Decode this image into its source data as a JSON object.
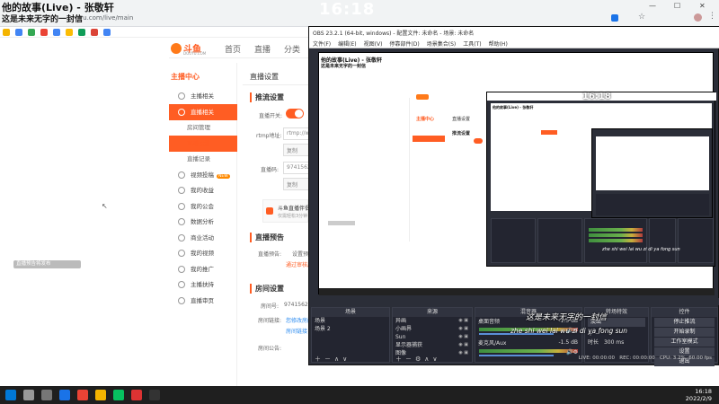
{
  "overlay": {
    "song_title": "他的故事(Live) - 张敬轩",
    "song_subtitle": "这是未来无字的一封信",
    "clock": "16:18",
    "lyric_cn": "这是未来无字的一封信",
    "lyric_pinyin": "zhe shi wei lai wu zi di ya fong sun"
  },
  "browser": {
    "address": "yu.com/live/main",
    "right_icons": [
      "extension-icon",
      "star-icon",
      "menu-icon"
    ]
  },
  "douyu": {
    "logo_text": "斗鱼",
    "logo_sub": "DOUYU.COM",
    "nav": [
      "首页",
      "直播",
      "分类"
    ],
    "menu_title": "主播中心",
    "menu": [
      {
        "label": "主播相关",
        "icon": "user-icon",
        "active": false,
        "sub": false
      },
      {
        "label": "直播相关",
        "icon": "video-icon",
        "active": true,
        "sub": false
      },
      {
        "label": "房间管理",
        "sub": true,
        "active": false
      },
      {
        "label": "直播设置",
        "sub": true,
        "active": true
      },
      {
        "label": "直播记录",
        "sub": true,
        "active": false
      },
      {
        "label": "视频投稿",
        "icon": "film-icon",
        "active": false,
        "sub": false,
        "badge": "NEW"
      },
      {
        "label": "我的收益",
        "icon": "coin-icon",
        "active": false,
        "sub": false
      },
      {
        "label": "我的公会",
        "icon": "guild-icon",
        "active": false,
        "sub": false
      },
      {
        "label": "数据分析",
        "icon": "chart-icon",
        "active": false,
        "sub": false
      },
      {
        "label": "商业活动",
        "icon": "briefcase-icon",
        "active": false,
        "sub": false
      },
      {
        "label": "我的视频",
        "icon": "play-icon",
        "active": false,
        "sub": false
      },
      {
        "label": "我的推广",
        "icon": "megaphone-icon",
        "active": false,
        "sub": false
      },
      {
        "label": "主播扶持",
        "icon": "support-icon",
        "active": false,
        "sub": false
      },
      {
        "label": "直播审页",
        "icon": "doc-icon",
        "active": false,
        "sub": false
      }
    ],
    "panel_title": "直播设置",
    "sec_stream": "推流设置",
    "switch_label": "直播开关:",
    "rtmp_label": "rtmp地址:",
    "rtmp_value": "rtmp://w",
    "copy1": "复制",
    "code_label": "直播码:",
    "code_value": "9741562",
    "copy2": "复制",
    "promo_title": "斗鱼直播伴侣",
    "promo_sub": "仅需轻松3分钟",
    "sec_preview": "直播预告",
    "preview_label": "直播预告:",
    "preview_value": "设置预",
    "preview_link": "通过审核后",
    "sec_room": "房间设置",
    "room_label": "房间号:",
    "room_value": "9741562",
    "room_link_label": "房间链接:",
    "room_link": "您修改房间",
    "room_link2": "房间链接",
    "announce_label": "房间公告:",
    "left_pill": "直播预告将发布"
  },
  "obs": {
    "title": "OBS 23.2.1 (64-bit, windows) - 配置文件: 未命名 - 场景: 未命名",
    "menus": [
      "文件(F)",
      "编辑(E)",
      "视图(V)",
      "停靠部件(D)",
      "场景集合(S)",
      "工具(T)",
      "帮助(H)"
    ],
    "scenes_header": "场景",
    "scenes": [
      "场景",
      "场景 2"
    ],
    "sources_header": "来源",
    "sources": [
      "异画",
      "小画界",
      "Sun",
      "显示器捕获",
      "图像"
    ],
    "mixer_header": "混音器",
    "mixer": [
      {
        "name": "桌面音频",
        "db": "-1.5 dB"
      },
      {
        "name": "麦克风/Aux",
        "db": "-1.5 dB"
      }
    ],
    "transitions_header": "转场特效",
    "transition_value": "淡出",
    "duration_label": "时长",
    "duration_value": "300 ms",
    "controls_header": "控件",
    "controls": [
      "停止推流",
      "开始录制",
      "工作室模式",
      "设置",
      "退出"
    ],
    "status": {
      "live": "LIVE: 00:00:00",
      "rec": "REC: 00:00:00",
      "cpu": "CPU: 3.2%, 60.00 fps"
    }
  },
  "taskbar": {
    "time": "16:18",
    "date": "2022/2/9",
    "icons": [
      "windows-icon",
      "search-icon",
      "taskview-icon",
      "edge-icon",
      "chrome-icon",
      "folder-icon",
      "wechat-icon",
      "music-icon",
      "obs-icon"
    ]
  },
  "colors": {
    "accent": "#ff5d23",
    "obs_bg": "#2b2e38",
    "taskbar": "#1f1f1f"
  }
}
